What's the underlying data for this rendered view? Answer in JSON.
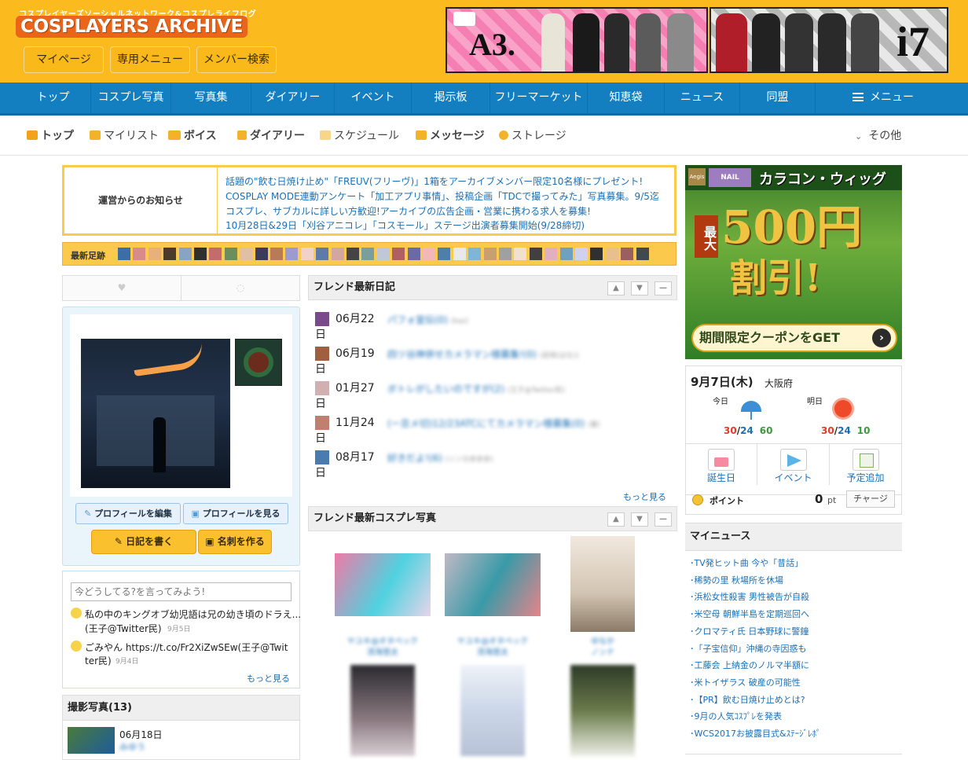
{
  "header": {
    "logo_sub": "コスプレイヤーズソーシャルネットワーク&コスプレライフログ",
    "logo": "COSPLAYERS ARCHIVE",
    "buttons": [
      "マイページ",
      "専用メニュー",
      "メンバー検索"
    ],
    "banner1_big": "A3.",
    "banner2_big": "i7"
  },
  "nav": [
    "トップ",
    "コスプレ写真",
    "写真集",
    "ダイアリー",
    "イベント",
    "掲示板",
    "フリーマーケット",
    "知恵袋",
    "ニュース",
    "同盟",
    "メニュー"
  ],
  "subnav": [
    {
      "label": "トップ",
      "bold": true,
      "color": "#f2a31b"
    },
    {
      "label": "マイリスト",
      "bold": false,
      "color": "#f2b32b"
    },
    {
      "label": "ボイス",
      "bold": true,
      "color": "#f2b32b"
    },
    {
      "label": "ダイアリー",
      "bold": true,
      "color": "#f2b32b"
    },
    {
      "label": "スケジュール",
      "bold": false,
      "color": "#f7d58a"
    },
    {
      "label": "メッセージ",
      "bold": true,
      "color": "#f2b32b"
    },
    {
      "label": "ストレージ",
      "bold": false,
      "color": "#f2b32b"
    }
  ],
  "subnav_other": "その他",
  "notice": {
    "label": "運営からのお知らせ",
    "lines": [
      "話題の\"飲む日焼け止め\"「FREUV(フリーヴ)」1箱をアーカイブメンバー限定10名様にプレゼント!",
      "COSPLAY MODE連動アンケート「加工アプリ事情」、投稿企画「TDCで撮ってみた」写真募集。9/5迄",
      "コスプレ、サブカルに詳しい方歓迎!アーカイブの広告企画・営業に携わる求人を募集!",
      "10月28日&29日「刈谷アニコレ」「コスモール」ステージ出演者募集開始(9/28締切)"
    ]
  },
  "footprint": {
    "label": "最新足跡"
  },
  "profile": {
    "edit": "プロフィールを編集",
    "view": "プロフィールを見る",
    "write_diary": "日記を書く",
    "make_card": "名刺を作る"
  },
  "voice": {
    "placeholder": "今どうしてる?を言ってみよう!",
    "items": [
      {
        "text": "私の中のキングオブ幼児語は兄の幼き頃のドラえ...",
        "author": "(王子@Twitter民)",
        "date": "9月5日"
      },
      {
        "text": "ごみやん https://t.co/Fr2XiZwSEw(王子@Twit",
        "text2": "ter民)",
        "date": "9月4日"
      }
    ],
    "more": "もっと見る"
  },
  "photos": {
    "title": "撮影写真(13)",
    "date": "06月18日",
    "name": "みゆう"
  },
  "diary": {
    "title": "フレンド最新日記",
    "items": [
      {
        "date": "06月22",
        "day": "日",
        "title": "パフォ宣伝(0)",
        "sub": "(kaz)"
      },
      {
        "date": "06月19",
        "day": "日",
        "title": "四ツ谷神併せカメラマン様募集!(0)",
        "sub": "(凪咲(はな))"
      },
      {
        "date": "01月27",
        "day": "日",
        "title": "ボトレがしたいのですが(2)",
        "sub": "(王子@Twitter民)"
      },
      {
        "date": "11月24",
        "day": "日",
        "title": "(ー旦メ切)12/23ATCにてカメラマン様募集(0)",
        "sub": "(春日えしも)"
      },
      {
        "date": "08月17",
        "day": "日",
        "title": "好きだよ!(6)",
        "sub": "(ソン分余余余)"
      }
    ],
    "more": "もっと見る"
  },
  "cosphoto": {
    "title": "フレンド最新コスプレ写真",
    "captions": [
      [
        "ヤユキ@オタペック",
        "流海悠太"
      ],
      [
        "ヤユキ@オタペック",
        "流海悠太"
      ],
      [
        "ゆなか",
        "ノンナ"
      ]
    ]
  },
  "ad": {
    "brand1": "Aegis",
    "brand2": "NAIL",
    "title": "カラコン・ウィッグ",
    "max": "最大",
    "amount": "500円",
    "off": "割引!",
    "cta": "期間限定クーポンをGET"
  },
  "weather": {
    "date": "9月7日(木)",
    "place": "大阪府",
    "today": "今日",
    "tomorrow": "明日",
    "today_high": "30",
    "today_low": "24",
    "today_rain": "60",
    "tomorrow_high": "30",
    "tomorrow_low": "24",
    "tomorrow_rain": "10",
    "sep": "/"
  },
  "quick": [
    "誕生日",
    "イベント",
    "予定追加"
  ],
  "points": {
    "label": "ポイント",
    "value": "0",
    "unit": "pt",
    "charge": "チャージ"
  },
  "mynews": {
    "title": "マイニュース",
    "items": [
      "TV発ヒット曲 今や「昔話」",
      "稀勢の里 秋場所を休場",
      "浜松女性殺害 男性被告が自殺",
      "米空母 朝鮮半島を定期巡回へ",
      "クロマティ氏 日本野球に警鐘",
      "「子宝信仰」沖縄の寺因惑も",
      "工藤会 上納金のノルマ半額に",
      "米トイザラス 破産の可能性",
      "【PR】飲む日焼け止めとは?",
      "9月の人気ｺｽﾌﾟﾚを発表",
      "WCS2017お披露目式&ｽﾃｰｼﾞﾚﾎﾟ"
    ]
  }
}
